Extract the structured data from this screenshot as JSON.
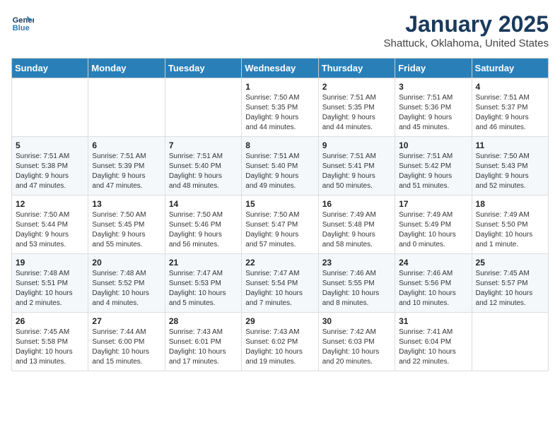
{
  "header": {
    "logo_line1": "General",
    "logo_line2": "Blue",
    "title": "January 2025",
    "subtitle": "Shattuck, Oklahoma, United States"
  },
  "days_of_week": [
    "Sunday",
    "Monday",
    "Tuesday",
    "Wednesday",
    "Thursday",
    "Friday",
    "Saturday"
  ],
  "weeks": [
    [
      {
        "day": "",
        "info": ""
      },
      {
        "day": "",
        "info": ""
      },
      {
        "day": "",
        "info": ""
      },
      {
        "day": "1",
        "info": "Sunrise: 7:50 AM\nSunset: 5:35 PM\nDaylight: 9 hours\nand 44 minutes."
      },
      {
        "day": "2",
        "info": "Sunrise: 7:51 AM\nSunset: 5:35 PM\nDaylight: 9 hours\nand 44 minutes."
      },
      {
        "day": "3",
        "info": "Sunrise: 7:51 AM\nSunset: 5:36 PM\nDaylight: 9 hours\nand 45 minutes."
      },
      {
        "day": "4",
        "info": "Sunrise: 7:51 AM\nSunset: 5:37 PM\nDaylight: 9 hours\nand 46 minutes."
      }
    ],
    [
      {
        "day": "5",
        "info": "Sunrise: 7:51 AM\nSunset: 5:38 PM\nDaylight: 9 hours\nand 47 minutes."
      },
      {
        "day": "6",
        "info": "Sunrise: 7:51 AM\nSunset: 5:39 PM\nDaylight: 9 hours\nand 47 minutes."
      },
      {
        "day": "7",
        "info": "Sunrise: 7:51 AM\nSunset: 5:40 PM\nDaylight: 9 hours\nand 48 minutes."
      },
      {
        "day": "8",
        "info": "Sunrise: 7:51 AM\nSunset: 5:40 PM\nDaylight: 9 hours\nand 49 minutes."
      },
      {
        "day": "9",
        "info": "Sunrise: 7:51 AM\nSunset: 5:41 PM\nDaylight: 9 hours\nand 50 minutes."
      },
      {
        "day": "10",
        "info": "Sunrise: 7:51 AM\nSunset: 5:42 PM\nDaylight: 9 hours\nand 51 minutes."
      },
      {
        "day": "11",
        "info": "Sunrise: 7:50 AM\nSunset: 5:43 PM\nDaylight: 9 hours\nand 52 minutes."
      }
    ],
    [
      {
        "day": "12",
        "info": "Sunrise: 7:50 AM\nSunset: 5:44 PM\nDaylight: 9 hours\nand 53 minutes."
      },
      {
        "day": "13",
        "info": "Sunrise: 7:50 AM\nSunset: 5:45 PM\nDaylight: 9 hours\nand 55 minutes."
      },
      {
        "day": "14",
        "info": "Sunrise: 7:50 AM\nSunset: 5:46 PM\nDaylight: 9 hours\nand 56 minutes."
      },
      {
        "day": "15",
        "info": "Sunrise: 7:50 AM\nSunset: 5:47 PM\nDaylight: 9 hours\nand 57 minutes."
      },
      {
        "day": "16",
        "info": "Sunrise: 7:49 AM\nSunset: 5:48 PM\nDaylight: 9 hours\nand 58 minutes."
      },
      {
        "day": "17",
        "info": "Sunrise: 7:49 AM\nSunset: 5:49 PM\nDaylight: 10 hours\nand 0 minutes."
      },
      {
        "day": "18",
        "info": "Sunrise: 7:49 AM\nSunset: 5:50 PM\nDaylight: 10 hours\nand 1 minute."
      }
    ],
    [
      {
        "day": "19",
        "info": "Sunrise: 7:48 AM\nSunset: 5:51 PM\nDaylight: 10 hours\nand 2 minutes."
      },
      {
        "day": "20",
        "info": "Sunrise: 7:48 AM\nSunset: 5:52 PM\nDaylight: 10 hours\nand 4 minutes."
      },
      {
        "day": "21",
        "info": "Sunrise: 7:47 AM\nSunset: 5:53 PM\nDaylight: 10 hours\nand 5 minutes."
      },
      {
        "day": "22",
        "info": "Sunrise: 7:47 AM\nSunset: 5:54 PM\nDaylight: 10 hours\nand 7 minutes."
      },
      {
        "day": "23",
        "info": "Sunrise: 7:46 AM\nSunset: 5:55 PM\nDaylight: 10 hours\nand 8 minutes."
      },
      {
        "day": "24",
        "info": "Sunrise: 7:46 AM\nSunset: 5:56 PM\nDaylight: 10 hours\nand 10 minutes."
      },
      {
        "day": "25",
        "info": "Sunrise: 7:45 AM\nSunset: 5:57 PM\nDaylight: 10 hours\nand 12 minutes."
      }
    ],
    [
      {
        "day": "26",
        "info": "Sunrise: 7:45 AM\nSunset: 5:58 PM\nDaylight: 10 hours\nand 13 minutes."
      },
      {
        "day": "27",
        "info": "Sunrise: 7:44 AM\nSunset: 6:00 PM\nDaylight: 10 hours\nand 15 minutes."
      },
      {
        "day": "28",
        "info": "Sunrise: 7:43 AM\nSunset: 6:01 PM\nDaylight: 10 hours\nand 17 minutes."
      },
      {
        "day": "29",
        "info": "Sunrise: 7:43 AM\nSunset: 6:02 PM\nDaylight: 10 hours\nand 19 minutes."
      },
      {
        "day": "30",
        "info": "Sunrise: 7:42 AM\nSunset: 6:03 PM\nDaylight: 10 hours\nand 20 minutes."
      },
      {
        "day": "31",
        "info": "Sunrise: 7:41 AM\nSunset: 6:04 PM\nDaylight: 10 hours\nand 22 minutes."
      },
      {
        "day": "",
        "info": ""
      }
    ]
  ]
}
